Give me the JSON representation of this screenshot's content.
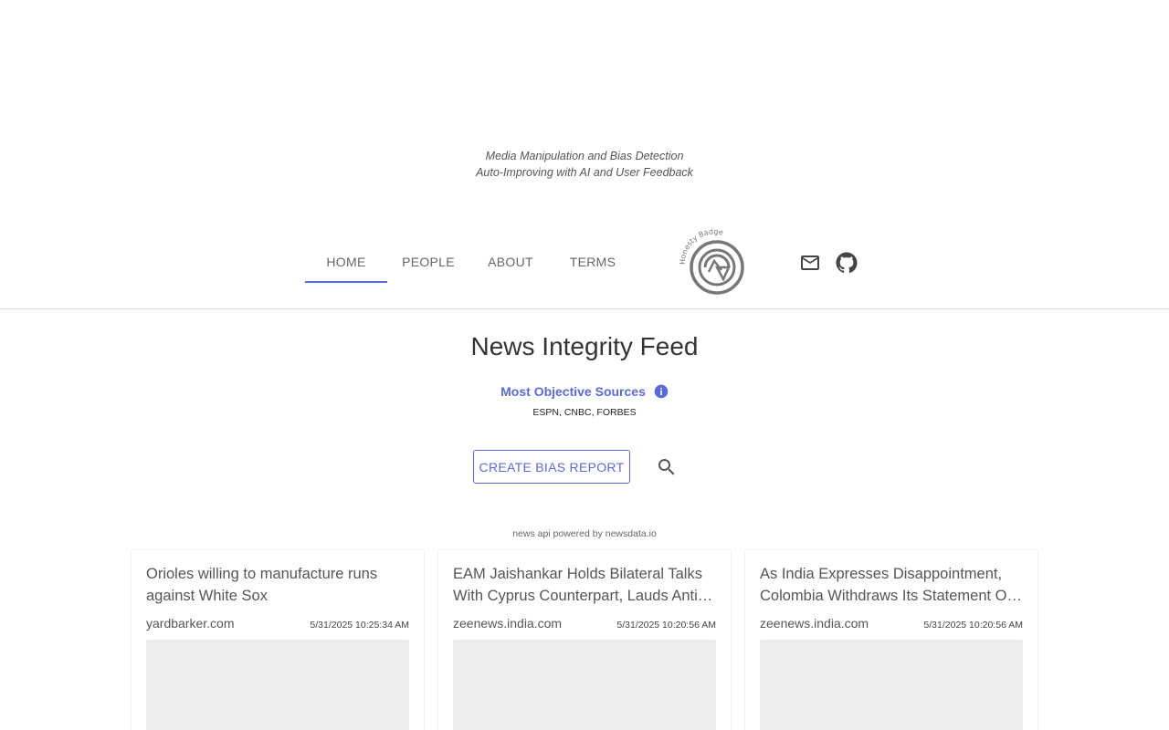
{
  "header": {
    "tagline_line1": "Media Manipulation and Bias Detection",
    "tagline_line2": "Auto-Improving with AI and User Feedback"
  },
  "nav": {
    "tabs": [
      {
        "label": "HOME",
        "active": true
      },
      {
        "label": "PEOPLE",
        "active": false
      },
      {
        "label": "ABOUT",
        "active": false
      },
      {
        "label": "TERMS",
        "active": false
      }
    ],
    "logo_text": "Honesty Badge",
    "icons": [
      "mail-icon",
      "github-icon"
    ]
  },
  "main": {
    "title": "News Integrity Feed",
    "objective_label": "Most Objective Sources",
    "objective_sources": "ESPN, CNBC, FORBES",
    "create_button": "CREATE BIAS REPORT",
    "powered_by": "news api powered by newsdata.io"
  },
  "articles": [
    {
      "title": "Orioles willing to manufacture runs against White Sox",
      "source": "yardbarker.com",
      "date": "5/31/2025 10:25:34 AM"
    },
    {
      "title": "EAM Jaishankar Holds Bilateral Talks With Cyprus Counterpart, Lauds Anti-Terror Support",
      "source": "zeenews.india.com",
      "date": "5/31/2025 10:20:56 AM"
    },
    {
      "title": "As India Expresses Disappointment, Colombia Withdraws Its Statement On Pakistan",
      "source": "zeenews.india.com",
      "date": "5/31/2025 10:20:56 AM"
    }
  ],
  "colors": {
    "accent": "#5b6bd6",
    "divider": "#dddddd",
    "image_placeholder": "#eeeeee"
  }
}
